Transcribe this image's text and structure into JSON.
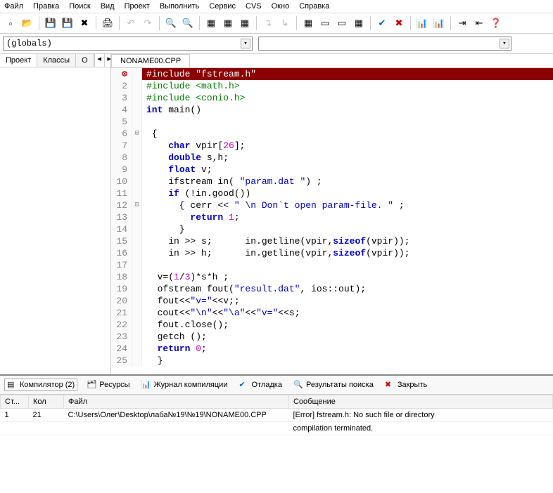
{
  "menu": [
    "Файл",
    "Правка",
    "Поиск",
    "Вид",
    "Проект",
    "Выполнить",
    "Сервис",
    "CVS",
    "Окно",
    "Справка"
  ],
  "combo1": "(globals)",
  "sideTabs": [
    "Проект",
    "Классы",
    "О"
  ],
  "editorTab": "NONAME00.CPP",
  "code": [
    {
      "n": "",
      "f": "",
      "err": true,
      "html": "#include \"fstream.h\"",
      "hl": true
    },
    {
      "n": "2",
      "f": "",
      "html": "<span class='kw-green'>#include &lt;math.h&gt;</span>"
    },
    {
      "n": "3",
      "f": "",
      "html": "<span class='kw-green'>#include &lt;conio.h&gt;</span>"
    },
    {
      "n": "4",
      "f": "",
      "html": "<span class='kw-blue'>int</span> main<span>()</span>"
    },
    {
      "n": "5",
      "f": "",
      "html": ""
    },
    {
      "n": "6",
      "f": "⊟",
      "html": " {"
    },
    {
      "n": "7",
      "f": "",
      "html": "    <span class='kw-blue'>char</span> vpir[<span class='num'>26</span>];"
    },
    {
      "n": "8",
      "f": "",
      "html": "    <span class='kw-blue'>double</span> s,h;"
    },
    {
      "n": "9",
      "f": "",
      "html": "    <span class='kw-blue'>float</span> v;"
    },
    {
      "n": "10",
      "f": "",
      "html": "    ifstream in( <span class='str'>\"param.dat \"</span>) ;"
    },
    {
      "n": "11",
      "f": "",
      "html": "    <span class='kw-blue'>if</span> (!in.good())"
    },
    {
      "n": "12",
      "f": "⊟",
      "html": "      { cerr &lt;&lt; <span class='str'>\" \\n Don`t open param-file. \"</span> ;"
    },
    {
      "n": "13",
      "f": "",
      "html": "        <span class='kw-blue'>return</span> <span class='num'>1</span>;"
    },
    {
      "n": "14",
      "f": "",
      "html": "      }"
    },
    {
      "n": "15",
      "f": "",
      "html": "    in &gt;&gt; s;      in.getline(vpir,<span class='kw-blue'>sizeof</span>(vpir));"
    },
    {
      "n": "16",
      "f": "",
      "html": "    in &gt;&gt; h;      in.getline(vpir,<span class='kw-blue'>sizeof</span>(vpir));"
    },
    {
      "n": "17",
      "f": "",
      "html": ""
    },
    {
      "n": "18",
      "f": "",
      "html": "  v=(<span class='num'>1</span>/<span class='num'>3</span>)*s*h ;"
    },
    {
      "n": "19",
      "f": "",
      "html": "  ofstream fout(<span class='str'>\"result.dat\"</span>, ios::out);"
    },
    {
      "n": "20",
      "f": "",
      "html": "  fout&lt;&lt;<span class='str'>\"v=\"</span>&lt;&lt;v;;"
    },
    {
      "n": "21",
      "f": "",
      "html": "  cout&lt;&lt;<span class='str'>\"\\n\"</span>&lt;&lt;<span class='str'>\"\\a\"</span>&lt;&lt;<span class='str'>\"v=\"</span>&lt;&lt;s;"
    },
    {
      "n": "22",
      "f": "",
      "html": "  fout.close();"
    },
    {
      "n": "23",
      "f": "",
      "html": "  getch ();"
    },
    {
      "n": "24",
      "f": "",
      "html": "  <span class='kw-blue'>return</span> <span class='num'>0</span>;"
    },
    {
      "n": "25",
      "f": "",
      "html": "  }"
    }
  ],
  "panelTabs": {
    "compiler": "Компилятор (2)",
    "resources": "Ресурсы",
    "log": "Журнал компиляции",
    "debug": "Отладка",
    "search": "Результаты поиска",
    "close": "Закрыть"
  },
  "msgHeaders": {
    "line": "Ст...",
    "col": "Кол",
    "file": "Файл",
    "msg": "Сообщение"
  },
  "msgs": [
    {
      "line": "1",
      "col": "21",
      "file": "C:\\Users\\Олег\\Desktop\\лаба№19\\№19\\NONAME00.CPP",
      "msg": "[Error] fstream.h: No such file or directory"
    },
    {
      "line": "",
      "col": "",
      "file": "",
      "msg": "compilation terminated."
    }
  ]
}
